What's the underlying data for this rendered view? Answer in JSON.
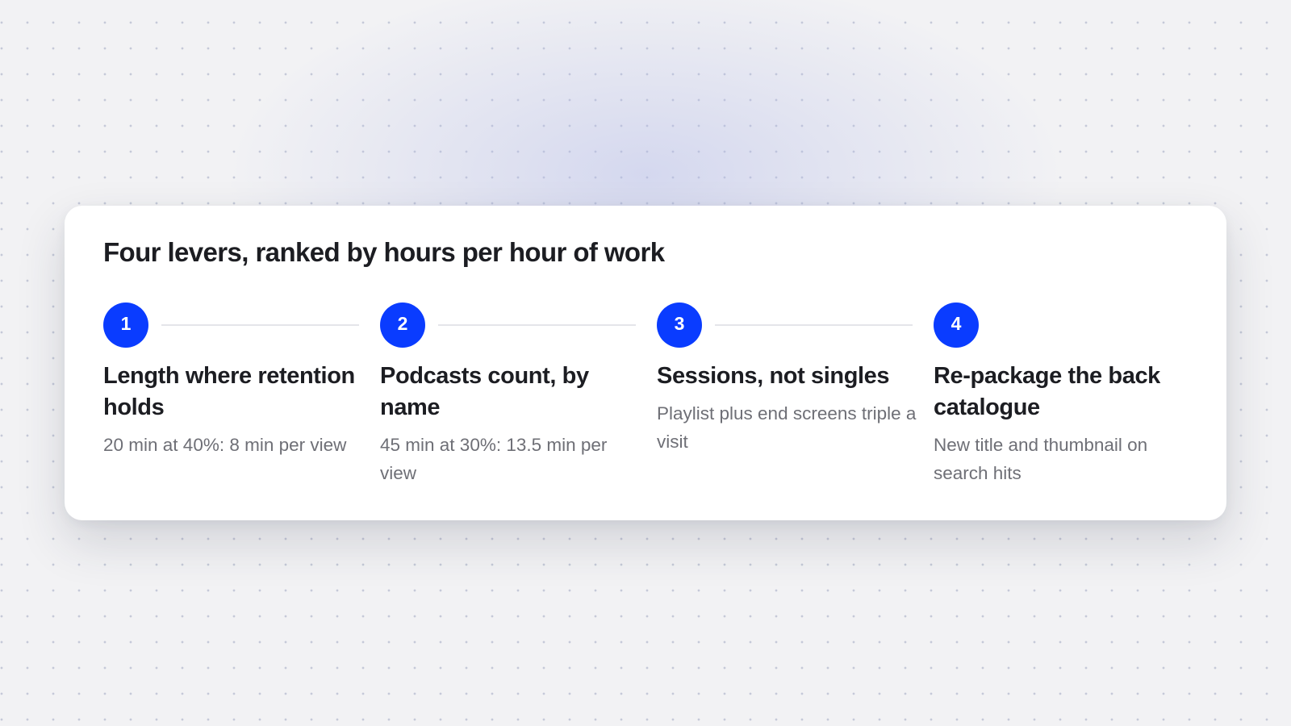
{
  "card": {
    "title": "Four levers, ranked by hours per hour of work"
  },
  "steps": [
    {
      "number": "1",
      "title": "Length where retention holds",
      "description": "20 min at 40%: 8 min per view"
    },
    {
      "number": "2",
      "title": "Podcasts count, by name",
      "description": "45 min at 30%: 13.5 min per view"
    },
    {
      "number": "3",
      "title": "Sessions, not singles",
      "description": "Playlist plus end screens triple a visit"
    },
    {
      "number": "4",
      "title": "Re-package the back catalogue",
      "description": "New title and thumbnail on search hits"
    }
  ],
  "colors": {
    "accent": "#0a3cff",
    "heading": "#1c1d22",
    "muted": "#6e6f76",
    "connector": "#e4e5ea",
    "page_background": "#f2f2f4",
    "card_background": "#ffffff"
  }
}
